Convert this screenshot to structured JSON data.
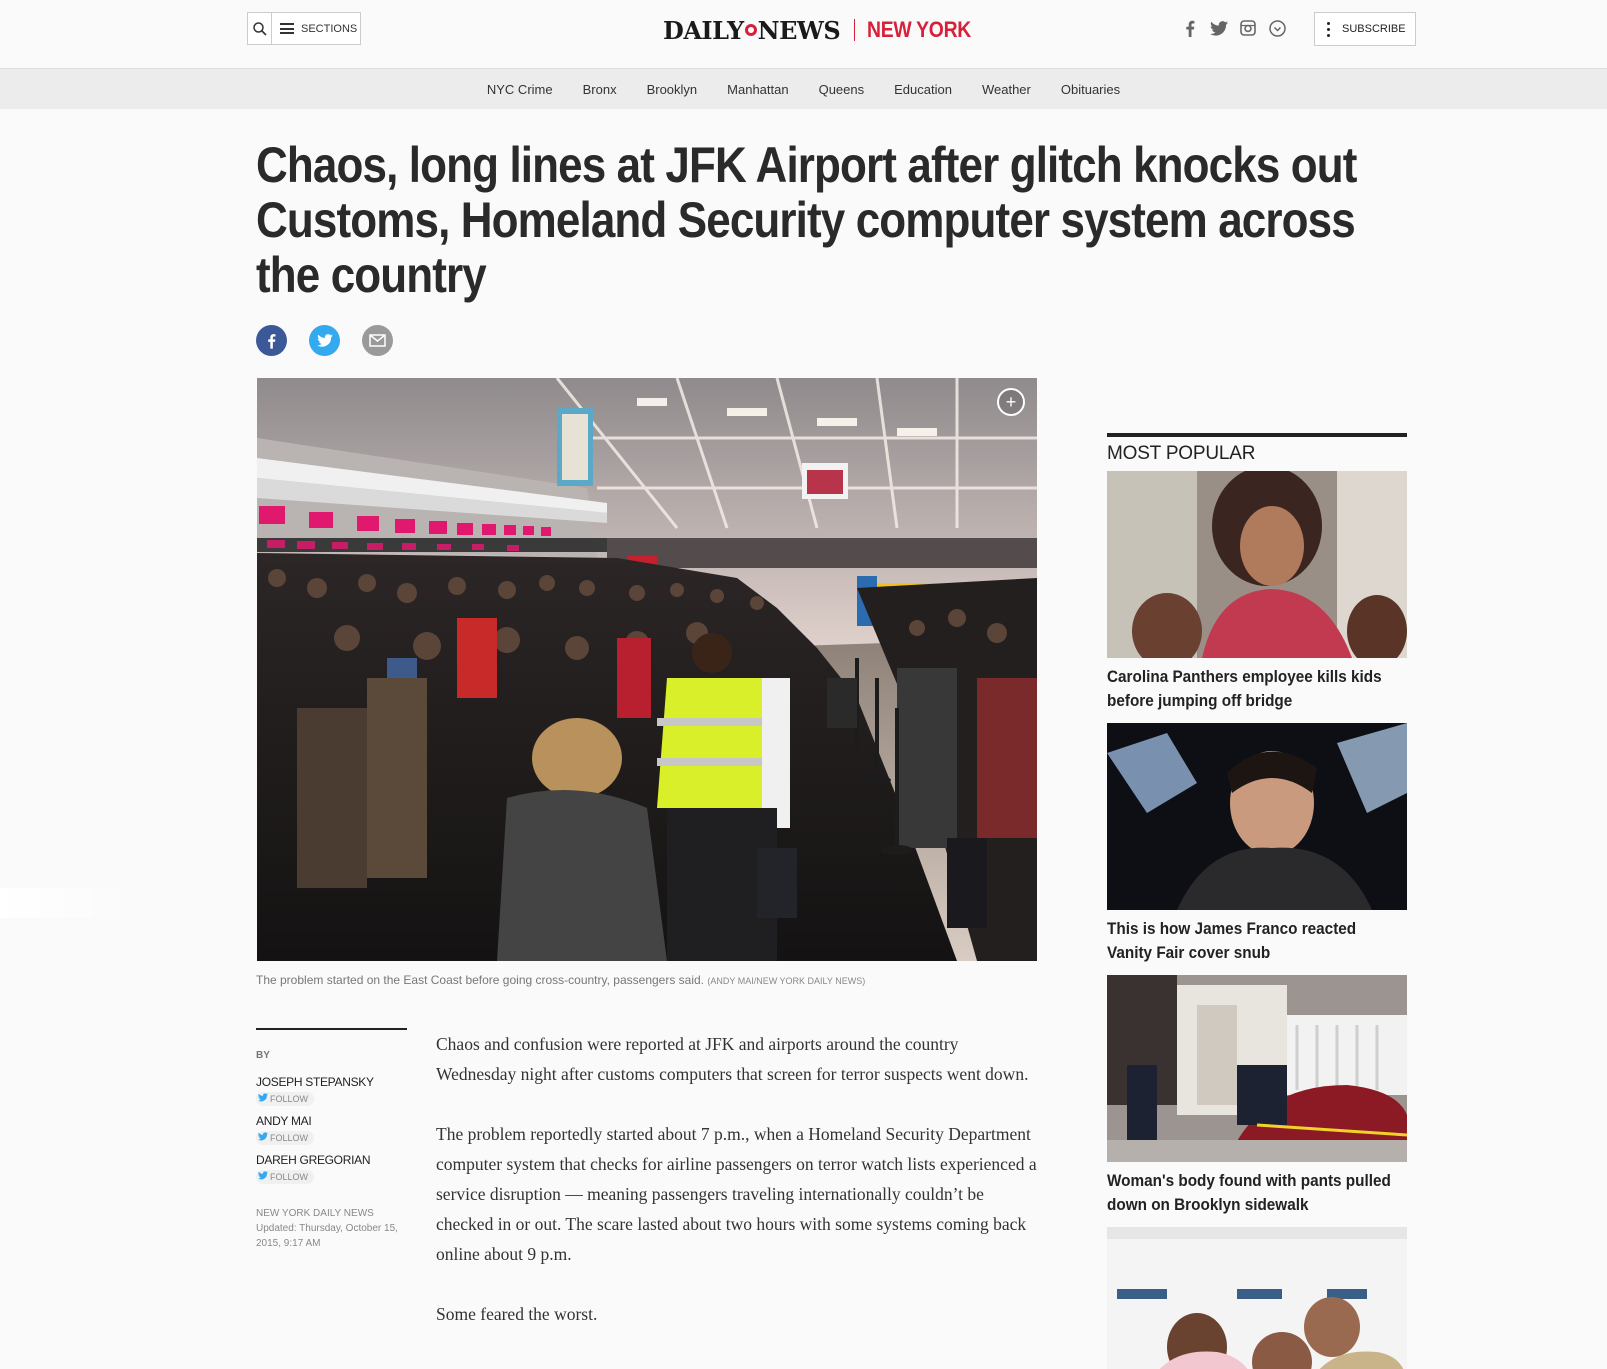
{
  "header": {
    "sections_label": "SECTIONS",
    "logo_daily": "DAILY",
    "logo_news": "NEWS",
    "logo_edition": "NEW YORK",
    "subscribe_label": "SUBSCRIBE",
    "social_icons": [
      "facebook-icon",
      "twitter-icon",
      "instagram-icon",
      "pinterest-icon"
    ]
  },
  "nav": {
    "items": [
      "NYC Crime",
      "Bronx",
      "Brooklyn",
      "Manhattan",
      "Queens",
      "Education",
      "Weather",
      "Obituaries"
    ]
  },
  "article": {
    "headline": "Chaos, long lines at JFK Airport after glitch knocks out Customs, Homeland Security computer system across the country",
    "share_icons": [
      "facebook-icon",
      "twitter-icon",
      "email-icon"
    ],
    "caption": "The problem started on the East Coast before going cross-country, passengers said.",
    "credit": "(ANDY MAI/NEW YORK DAILY NEWS)",
    "by_label": "BY",
    "authors": [
      "JOSEPH STEPANSKY",
      "ANDY MAI",
      "DAREH GREGORIAN"
    ],
    "follow_label": "FOLLOW",
    "publication": "NEW YORK DAILY NEWS",
    "updated": "Updated: Thursday, October 15, 2015, 9:17 AM",
    "paragraphs": [
      "Chaos and confusion were reported at JFK and airports around the country Wednesday night after customs computers that screen for terror suspects went down.",
      "The problem reportedly started about 7 p.m., when a Homeland Security Department computer system that checks for airline passengers on terror watch lists experienced a service disruption — meaning passengers traveling internationally couldn’t be checked in or out. The scare lasted about two hours with some systems coming back online about 9 p.m.",
      "Some feared the worst."
    ]
  },
  "sidebar": {
    "title": "MOST POPULAR",
    "items": [
      "Carolina Panthers employee kills kids before jumping off bridge",
      "This is how James Franco reacted Vanity Fair cover snub",
      "Woman's body found with pants pulled down on Brooklyn sidewalk"
    ]
  },
  "colors": {
    "brand_red": "#d8203b",
    "facebook": "#3b5998",
    "twitter": "#33aaf0"
  }
}
